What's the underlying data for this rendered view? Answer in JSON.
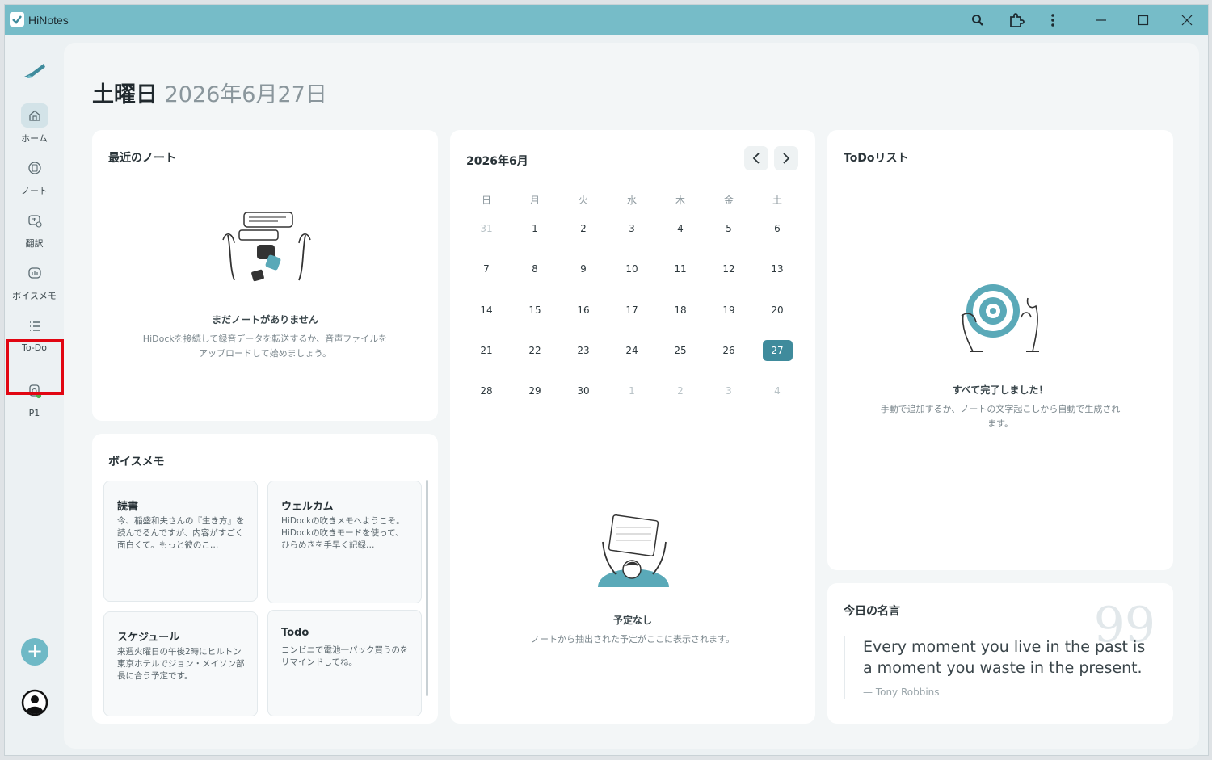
{
  "app": {
    "title": "HiNotes"
  },
  "sidebar": {
    "items": [
      {
        "label": "ホーム",
        "icon": "home-icon"
      },
      {
        "label": "ノート",
        "icon": "note-icon"
      },
      {
        "label": "翻訳",
        "icon": "translate-icon"
      },
      {
        "label": "ボイスメモ",
        "icon": "voice-memo-icon"
      },
      {
        "label": "To-Do",
        "icon": "todo-icon"
      },
      {
        "label": "P1",
        "icon": "device-icon"
      }
    ],
    "add_label": "+"
  },
  "header": {
    "day": "土曜日",
    "date": "2026年6月27日"
  },
  "recent_notes": {
    "title": "最近のノート",
    "empty_title": "まだノートがありません",
    "empty_desc_1": "HiDockを接続して録音データを転送するか、音声ファイルを",
    "empty_desc_2": "アップロードして始めましょう。"
  },
  "calendar": {
    "month_label": "2026年6月",
    "weekdays": [
      "日",
      "月",
      "火",
      "水",
      "木",
      "金",
      "土"
    ],
    "weeks": [
      [
        "31",
        "1",
        "2",
        "3",
        "4",
        "5",
        "6"
      ],
      [
        "7",
        "8",
        "9",
        "10",
        "11",
        "12",
        "13"
      ],
      [
        "14",
        "15",
        "16",
        "17",
        "18",
        "19",
        "20"
      ],
      [
        "21",
        "22",
        "23",
        "24",
        "25",
        "26",
        "27"
      ],
      [
        "28",
        "29",
        "30",
        "1",
        "2",
        "3",
        "4"
      ]
    ],
    "today": "27",
    "empty_title": "予定なし",
    "empty_desc": "ノートから抽出された予定がここに表示されます。"
  },
  "todo": {
    "title": "ToDoリスト",
    "empty_title": "すべて完了しました！",
    "empty_desc_1": "手動で追加するか、ノートの文字起こしから自動で生成され",
    "empty_desc_2": "ます。"
  },
  "voice_memos": {
    "title": "ボイスメモ",
    "items": [
      {
        "title": "読書",
        "text": "今、稲盛和夫さんの『生き方』を読んでるんですが、内容がすごく面白くて。もっと彼のこ…"
      },
      {
        "title": "ウェルカム",
        "text": "HiDockの吹きメモへようこそ。HiDockの吹きモードを使って、ひらめきを手早く記録…"
      },
      {
        "title": "スケジュール",
        "text": "来週火曜日の午後2時にヒルトン東京ホテルでジョン・メイソン部長に合う予定です。"
      },
      {
        "title": "Todo",
        "text": "コンビニで電池一パック買うのをリマインドしてね。"
      }
    ]
  },
  "quote": {
    "title": "今日の名言",
    "mark": "99",
    "text": "Every moment you live in the past is a moment you waste in the present.",
    "author": "— Tony Robbins"
  }
}
